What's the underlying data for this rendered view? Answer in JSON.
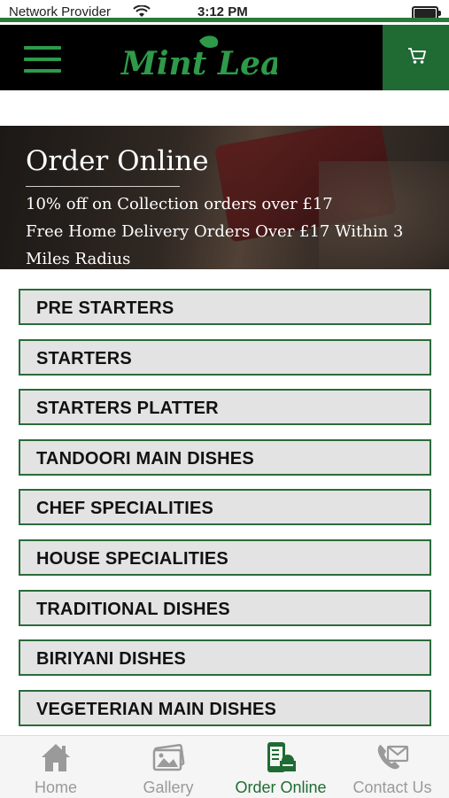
{
  "status_bar": {
    "carrier": "Network Provider",
    "time": "3:12 PM"
  },
  "header": {
    "logo_text": "Mint Leaf",
    "brand_color": "#1f6b33",
    "accent_color": "#2e9a4a"
  },
  "banner": {
    "title": "Order Online",
    "line1": "10% off on Collection orders over £17",
    "line2": "Free Home Delivery Orders Over £17 Within 3 Miles Radius"
  },
  "categories": [
    "PRE STARTERS",
    "STARTERS",
    "STARTERS PLATTER",
    "TANDOORI MAIN DISHES",
    "CHEF SPECIALITIES",
    "HOUSE SPECIALITIES",
    "TRADITIONAL DISHES",
    "BIRIYANI DISHES",
    "VEGETERIAN MAIN DISHES"
  ],
  "tabs": [
    {
      "label": "Home",
      "icon": "home-icon",
      "active": false
    },
    {
      "label": "Gallery",
      "icon": "gallery-icon",
      "active": false
    },
    {
      "label": "Order Online",
      "icon": "order-online-icon",
      "active": true
    },
    {
      "label": "Contact Us",
      "icon": "contact-icon",
      "active": false
    }
  ]
}
